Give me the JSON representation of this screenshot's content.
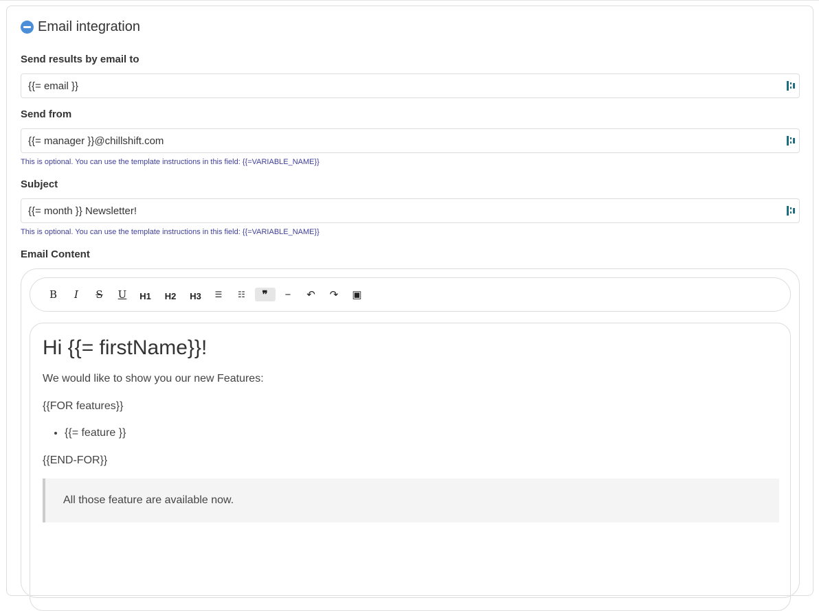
{
  "section": {
    "title": "Email integration",
    "icon": "minus-circle-icon",
    "accent": "#4a8fd8"
  },
  "fields": {
    "to": {
      "label": "Send results by email to",
      "value": "{{= email }}"
    },
    "from": {
      "label": "Send from",
      "value": "{{= manager }}@chillshift.com",
      "help": "This is optional. You can use the template instructions in this field: {{=VARIABLE_NAME}}"
    },
    "subject": {
      "label": "Subject",
      "value": "{{= month }} Newsletter!",
      "help": "This is optional. You can use the template instructions in this field: {{=VARIABLE_NAME}}"
    }
  },
  "editor": {
    "label": "Email Content",
    "toolbar": {
      "bold": "B",
      "italic": "I",
      "strike": "S",
      "underline": "U",
      "h1": "H1",
      "h2": "H2",
      "h3": "H3",
      "bullet": "☰",
      "ordered": "☷",
      "quote": "❞",
      "rule": "−",
      "undo": "↶",
      "redo": "↷",
      "image": "▣"
    },
    "content": {
      "heading": "Hi {{= firstName}}!",
      "intro": "We would like to show you our new Features:",
      "for_start": "{{FOR features}}",
      "list_item": "{{= feature }}",
      "for_end": "{{END-FOR}}",
      "quote": "All those feature are available now."
    }
  }
}
